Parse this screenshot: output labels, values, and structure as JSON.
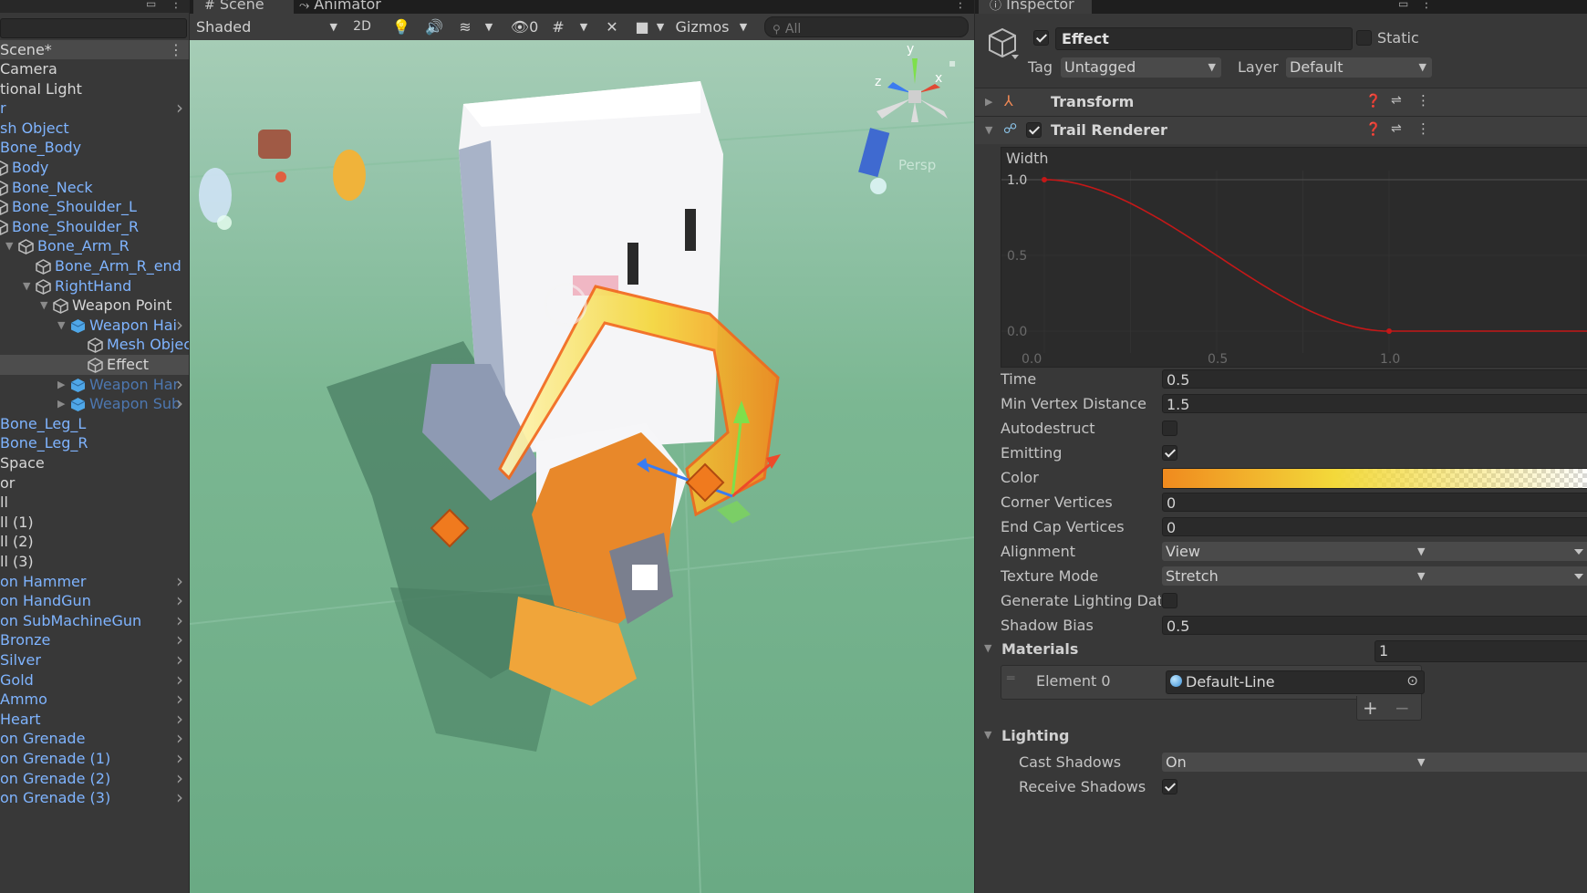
{
  "hierarchy": {
    "scene_title": "Scene*",
    "items": [
      {
        "label": "Camera",
        "style": "white",
        "indent": 0
      },
      {
        "label": "tional Light",
        "style": "white",
        "indent": 0
      },
      {
        "label": "r",
        "style": "blue",
        "indent": 0,
        "arrow": true
      },
      {
        "label": "sh Object",
        "style": "blue",
        "indent": 0
      },
      {
        "label": "Bone_Body",
        "style": "blue",
        "indent": 0
      },
      {
        "label": "Body",
        "style": "blue",
        "indent": 0,
        "icon": true
      },
      {
        "label": "Bone_Neck",
        "style": "blue",
        "indent": 0,
        "icon": true
      },
      {
        "label": "Bone_Shoulder_L",
        "style": "blue",
        "indent": 0,
        "icon": true
      },
      {
        "label": "Bone_Shoulder_R",
        "style": "blue",
        "indent": 0,
        "icon": true
      },
      {
        "label": "Bone_Arm_R",
        "style": "blue",
        "indent": 1,
        "icon": true,
        "expanded": true
      },
      {
        "label": "Bone_Arm_R_end",
        "style": "blue",
        "indent": 2,
        "icon": true
      },
      {
        "label": "RightHand",
        "style": "blue",
        "indent": 2,
        "icon": true,
        "expanded": true
      },
      {
        "label": "Weapon Point",
        "style": "white",
        "indent": 3,
        "icon": true,
        "expanded": true
      },
      {
        "label": "Weapon Hai",
        "style": "blue",
        "indent": 4,
        "icon": true,
        "prefab": true,
        "expanded": true,
        "arrow": true
      },
      {
        "label": "Mesh Object",
        "style": "blue",
        "indent": 5,
        "icon": true
      },
      {
        "label": "Effect",
        "style": "white",
        "indent": 5,
        "icon": true,
        "selected": true
      },
      {
        "label": "Weapon Har",
        "style": "dim",
        "indent": 4,
        "icon": true,
        "prefab": true,
        "collapsed": true,
        "arrow": true
      },
      {
        "label": "Weapon Sub",
        "style": "dim",
        "indent": 4,
        "icon": true,
        "prefab": true,
        "collapsed": true,
        "arrow": true
      },
      {
        "label": "Bone_Leg_L",
        "style": "blue",
        "indent": 0
      },
      {
        "label": "Bone_Leg_R",
        "style": "blue",
        "indent": 0
      },
      {
        "label": "Space",
        "style": "white",
        "indent": 0
      },
      {
        "label": "or",
        "style": "white",
        "indent": 0
      },
      {
        "label": "ll",
        "style": "white",
        "indent": 0
      },
      {
        "label": "ll (1)",
        "style": "white",
        "indent": 0
      },
      {
        "label": "ll (2)",
        "style": "white",
        "indent": 0
      },
      {
        "label": "ll (3)",
        "style": "white",
        "indent": 0
      },
      {
        "label": "on Hammer",
        "style": "blue",
        "indent": 0,
        "arrow": true
      },
      {
        "label": "on HandGun",
        "style": "blue",
        "indent": 0,
        "arrow": true
      },
      {
        "label": "on SubMachineGun",
        "style": "blue",
        "indent": 0,
        "arrow": true
      },
      {
        "label": "Bronze",
        "style": "blue",
        "indent": 0,
        "arrow": true
      },
      {
        "label": "Silver",
        "style": "blue",
        "indent": 0,
        "arrow": true
      },
      {
        "label": "Gold",
        "style": "blue",
        "indent": 0,
        "arrow": true
      },
      {
        "label": "Ammo",
        "style": "blue",
        "indent": 0,
        "arrow": true
      },
      {
        "label": "Heart",
        "style": "blue",
        "indent": 0,
        "arrow": true
      },
      {
        "label": "on Grenade",
        "style": "blue",
        "indent": 0,
        "arrow": true
      },
      {
        "label": "on Grenade (1)",
        "style": "blue",
        "indent": 0,
        "arrow": true
      },
      {
        "label": "on Grenade (2)",
        "style": "blue",
        "indent": 0,
        "arrow": true
      },
      {
        "label": "on Grenade (3)",
        "style": "blue",
        "indent": 0,
        "arrow": true
      }
    ]
  },
  "scene": {
    "tabs": {
      "scene": "Scene",
      "animator": "Animator"
    },
    "toolbar": {
      "shading": "Shaded",
      "mode_2d": "2D",
      "hidden_count": "0",
      "gizmos": "Gizmos",
      "search_placeholder": "All"
    },
    "gizmo_axes": {
      "y": "y",
      "x": "x",
      "z": "z"
    },
    "projection": "Persp"
  },
  "inspector": {
    "tab": "Inspector",
    "object_name": "Effect",
    "static_label": "Static",
    "tag_label": "Tag",
    "tag_value": "Untagged",
    "layer_label": "Layer",
    "layer_value": "Default",
    "transform_title": "Transform",
    "trail_title": "Trail Renderer",
    "width_curve": {
      "label": "Width",
      "y_ticks": [
        "1.0",
        "0.5",
        "0.0"
      ],
      "x_ticks": [
        "0.0",
        "0.5",
        "1.0"
      ],
      "keys": [
        {
          "time": 0.0,
          "value": 1.0
        },
        {
          "time": 1.0,
          "value": 0.0
        }
      ],
      "curve_color": "#c41818"
    },
    "fields": {
      "time": {
        "label": "Time",
        "value": "0.5"
      },
      "min_vertex": {
        "label": "Min Vertex Distance",
        "value": "1.5"
      },
      "autodestruct": {
        "label": "Autodestruct"
      },
      "emitting": {
        "label": "Emitting"
      },
      "color": {
        "label": "Color",
        "gradient_start": "#f08a1e",
        "gradient_end": "#f3d93a"
      },
      "corner_vertices": {
        "label": "Corner Vertices",
        "value": "0"
      },
      "end_cap": {
        "label": "End Cap Vertices",
        "value": "0"
      },
      "alignment": {
        "label": "Alignment",
        "value": "View"
      },
      "texture_mode": {
        "label": "Texture Mode",
        "value": "Stretch"
      },
      "generate_lighting": {
        "label": "Generate Lighting Dat"
      },
      "shadow_bias": {
        "label": "Shadow Bias",
        "value": "0.5"
      }
    },
    "materials": {
      "label": "Materials",
      "count": "1",
      "element_label": "Element 0",
      "element_value": "Default-Line"
    },
    "lighting": {
      "label": "Lighting",
      "cast_shadows_label": "Cast Shadows",
      "cast_shadows_value": "On",
      "receive_shadows_label": "Receive Shadows"
    }
  }
}
